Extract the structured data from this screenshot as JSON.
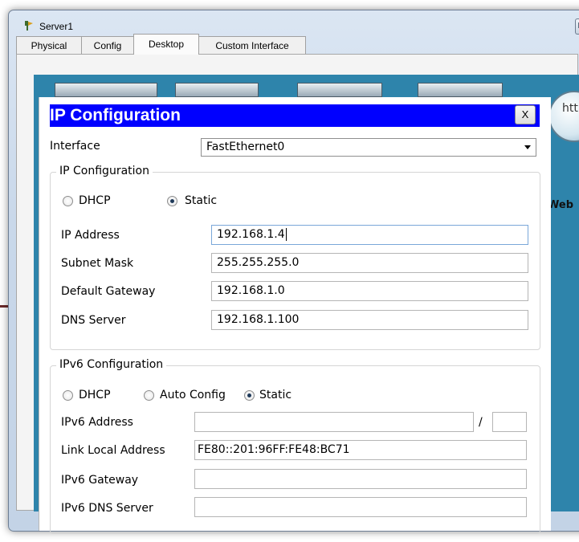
{
  "window": {
    "title": "Server1"
  },
  "tabs": [
    "Physical",
    "Config",
    "Desktop",
    "Custom Interface"
  ],
  "active_tab": "Desktop",
  "background": {
    "web_icon_text": "htt",
    "web_caption": "Web I"
  },
  "dialog": {
    "title": "IP Configuration",
    "close_label": "X",
    "interface_label": "Interface",
    "interface_value": "FastEthernet0",
    "ipv4": {
      "legend": "IP Configuration",
      "dhcp_label": "DHCP",
      "static_label": "Static",
      "mode": "Static",
      "ip_label": "IP Address",
      "ip_value": "192.168.1.4",
      "mask_label": "Subnet Mask",
      "mask_value": "255.255.255.0",
      "gateway_label": "Default Gateway",
      "gateway_value": "192.168.1.0",
      "dns_label": "DNS Server",
      "dns_value": "192.168.1.100"
    },
    "ipv6": {
      "legend": "IPv6 Configuration",
      "dhcp_label": "DHCP",
      "auto_label": "Auto Config",
      "static_label": "Static",
      "mode": "Static",
      "address_label": "IPv6 Address",
      "address_value": "",
      "prefix_separator": "/",
      "prefix_value": "",
      "link_local_label": "Link Local Address",
      "link_local_value": "FE80::201:96FF:FE48:BC71",
      "gateway_label": "IPv6 Gateway",
      "gateway_value": "",
      "dns_label": "IPv6 DNS Server",
      "dns_value": ""
    }
  },
  "colors": {
    "header_bg": "#0000ff",
    "desktop_bg": "#2e84ab"
  }
}
